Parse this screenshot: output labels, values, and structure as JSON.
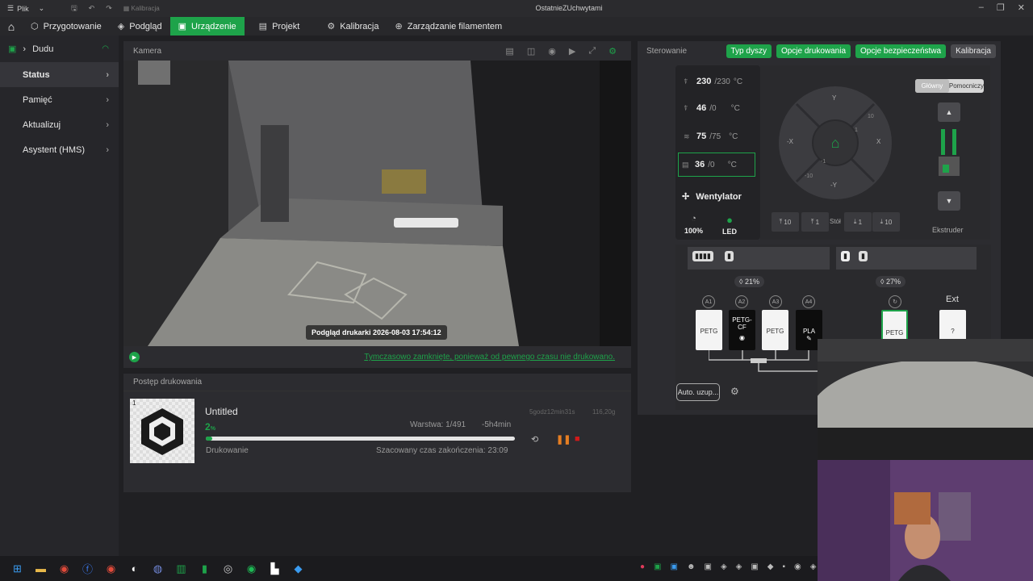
{
  "titlebar": {
    "file_menu": "Plik",
    "kalibracja_shortcut": "Kalibracja",
    "window_title": "OstatnieZUchwytami",
    "controls": [
      "–",
      "❐",
      "✕"
    ]
  },
  "nav": {
    "tabs": [
      {
        "label": "Przygotowanie",
        "active": false
      },
      {
        "label": "Podgląd",
        "active": false
      },
      {
        "label": "Urządzenie",
        "active": true
      },
      {
        "label": "Projekt",
        "active": false
      },
      {
        "label": "Kalibracja",
        "active": false
      },
      {
        "label": "Zarządzanie filamentem",
        "active": false
      }
    ]
  },
  "sidebar": {
    "printer_name": "Dudu",
    "items": [
      {
        "label": "Status",
        "active": true
      },
      {
        "label": "Pamięć",
        "active": false
      },
      {
        "label": "Aktualizuj",
        "active": false
      },
      {
        "label": "Asystent (HMS)",
        "active": false
      }
    ]
  },
  "camera": {
    "title": "Kamera",
    "timestamp": "Podgląd drukarki  2026-08-03  17:54:12",
    "message": "Tymczasowo zamknięte, ponieważ od pewnego czasu nie drukowano."
  },
  "progress": {
    "title": "Postęp drukowania",
    "plate_number": "1",
    "job_name": "Untitled",
    "percent": 2,
    "percent_text": "2",
    "percent_unit": "%",
    "layer": "Warstwa: 1/491",
    "remaining": "-5h4min",
    "total_time": "5godz12min31s",
    "weight": "116,20g",
    "state": "Drukowanie",
    "eta": "Szacowany czas zakończenia: 23:09"
  },
  "control": {
    "title": "Sterowanie",
    "tabs": [
      "Typ dyszy",
      "Opcje drukowania",
      "Opcje bezpieczeństwa",
      "Kalibracja"
    ],
    "temps": [
      {
        "value": "230",
        "target": "/230",
        "unit": "°C",
        "icon": "L"
      },
      {
        "value": "46",
        "target": "/0",
        "unit": "°C",
        "icon": "R"
      },
      {
        "value": "75",
        "target": "/75",
        "unit": "°C",
        "icon": "bed"
      },
      {
        "value": "36",
        "target": "/0",
        "unit": "°C",
        "icon": "chamber"
      }
    ],
    "fan_label": "Wentylator",
    "speed": "100%",
    "led": "LED",
    "jog_labels": {
      "y": "Y",
      "ny": "-Y",
      "x": "X",
      "nx": "-X",
      "p10": "10",
      "p1": "1",
      "n1": "-1",
      "n10": "-10"
    },
    "z_buttons": [
      "10",
      "1",
      "1",
      "10"
    ],
    "bed_label": "Stół",
    "extruder_tabs": [
      "Główny",
      "Pomocniczy"
    ],
    "extruder_label": "Ekstruder"
  },
  "ams": {
    "humidity_main": "21",
    "humidity_aux": "27",
    "humidity_unit": "%",
    "slots": [
      {
        "id": "A1",
        "material": "PETG",
        "color": "#f4f4f4"
      },
      {
        "id": "A2",
        "material": "PETG-CF",
        "color": "#0d0d0d"
      },
      {
        "id": "A3",
        "material": "PETG",
        "color": "#f4f4f4"
      },
      {
        "id": "A4",
        "material": "PLA",
        "color": "#0d0d0d"
      }
    ],
    "aux_slot": {
      "material": "PETG"
    },
    "ext_label": "Ext",
    "ext_slot": "?",
    "auto_refill": "Auto. uzup..."
  },
  "colors": {
    "accent": "#1ea34a",
    "panel": "#2c2c30",
    "background": "#1f1f22"
  }
}
